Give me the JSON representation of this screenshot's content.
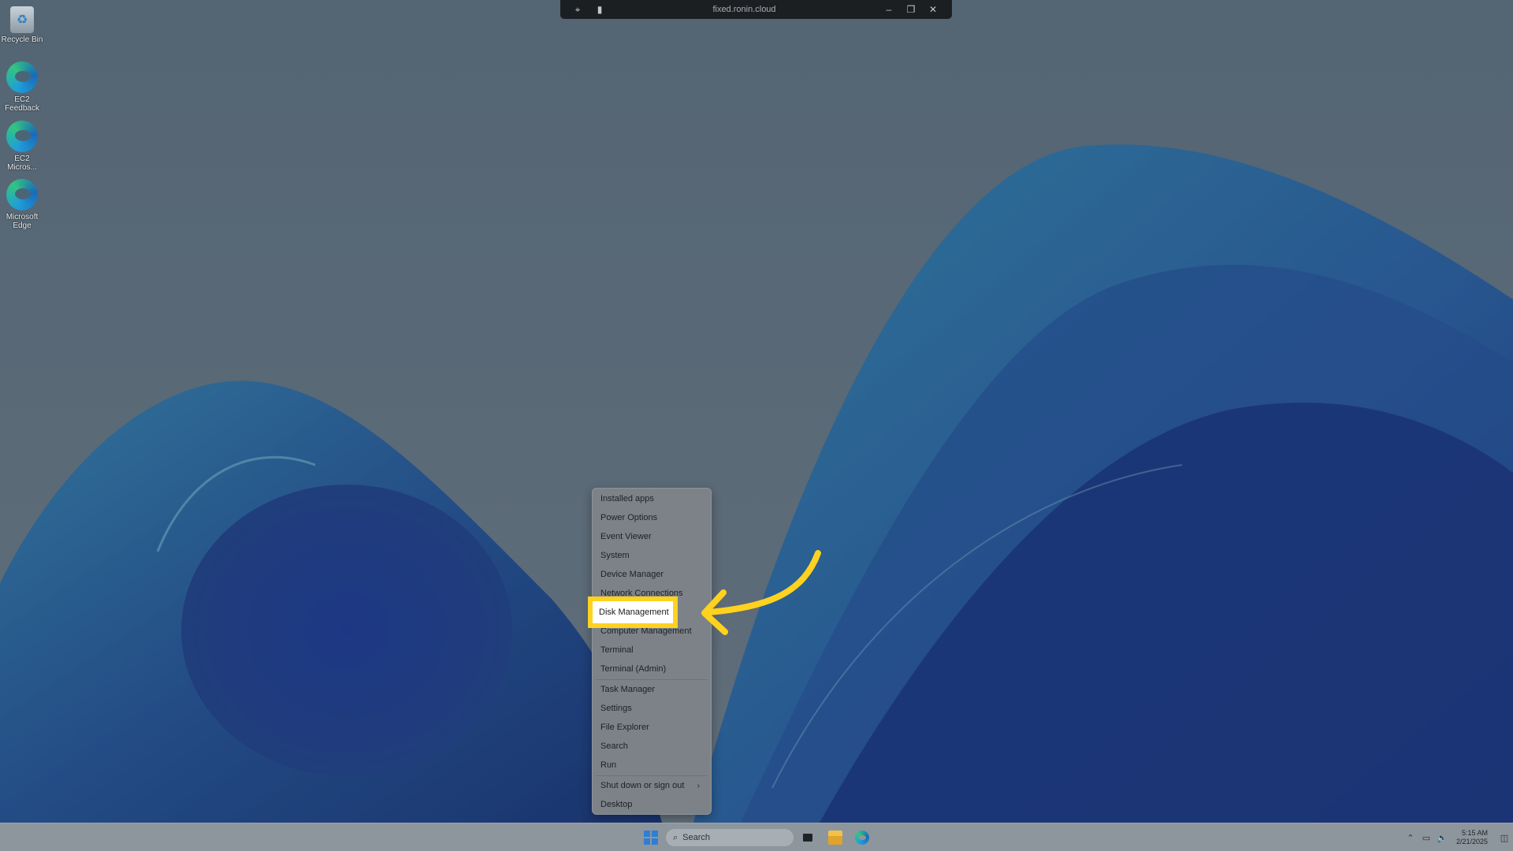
{
  "desktop": {
    "icons": [
      {
        "label": "Recycle Bin",
        "icon": "recycle-bin-icon"
      },
      {
        "label": "EC2 Feedback",
        "icon": "edge-icon"
      },
      {
        "label": "EC2 Micros...",
        "icon": "edge-icon"
      },
      {
        "label": "Microsoft Edge",
        "icon": "edge-icon"
      }
    ]
  },
  "session_bar": {
    "title": "fixed.ronin.cloud",
    "icons": [
      "unpin-icon",
      "signal-icon",
      "minimize-icon",
      "restore-icon",
      "close-icon"
    ]
  },
  "context_menu": {
    "items": [
      {
        "label": "Installed apps"
      },
      {
        "label": "Power Options"
      },
      {
        "label": "Event Viewer"
      },
      {
        "label": "System"
      },
      {
        "label": "Device Manager"
      },
      {
        "label": "Network Connections"
      },
      {
        "label": "Disk Management"
      },
      {
        "label": "Computer Management"
      },
      {
        "label": "Terminal"
      },
      {
        "label": "Terminal (Admin)"
      },
      {
        "label": "Task Manager"
      },
      {
        "label": "Settings"
      },
      {
        "label": "File Explorer"
      },
      {
        "label": "Search"
      },
      {
        "label": "Run"
      },
      {
        "label": "Shut down or sign out"
      },
      {
        "label": "Desktop"
      }
    ],
    "highlighted": "Disk Management",
    "highlight_color": "#ffd21f"
  },
  "taskbar": {
    "search_placeholder": "Search",
    "apps": [
      "start-icon",
      "task-view-icon",
      "file-explorer-icon",
      "edge-icon"
    ],
    "tray": {
      "time": "5:15 AM",
      "date": "2/21/2025"
    }
  }
}
